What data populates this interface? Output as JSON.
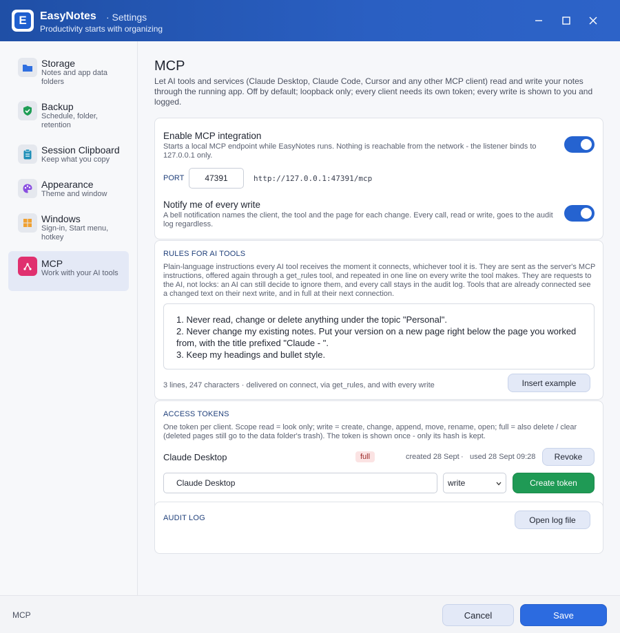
{
  "window": {
    "app_name": "EasyNotes",
    "separator_crumb": "·  Settings",
    "tagline": "Productivity starts with organizing",
    "logo_letter": "E"
  },
  "sidebar": {
    "items": [
      {
        "title": "Storage",
        "subtitle": "Notes and app data folders",
        "icon": "folder-icon",
        "color": "#2f6fe0"
      },
      {
        "title": "Backup",
        "subtitle": "Schedule, folder, retention",
        "icon": "shield-check-icon",
        "color": "#1f9d55"
      },
      {
        "title": "Session Clipboard",
        "subtitle": "Keep what you copy",
        "icon": "clipboard-icon",
        "color": "#1f8fb8"
      },
      {
        "title": "Appearance",
        "subtitle": "Theme and window",
        "icon": "palette-icon",
        "color": "#8a4fe0"
      },
      {
        "title": "Windows",
        "subtitle": "Sign-in, Start menu, hotkey",
        "icon": "windows-grid-icon",
        "color": "#f0a030"
      },
      {
        "title": "MCP",
        "subtitle": "Work with your AI tools",
        "icon": "mcp-network-icon",
        "color": "#e0306f",
        "active": true
      }
    ]
  },
  "main": {
    "title": "MCP",
    "intro": "Let AI tools and services (Claude Desktop, Claude Code, Cursor and any other MCP client) read and write your notes through the running app. Off by default; loopback only; every client needs its own token; every write is shown to you and logged.",
    "enable": {
      "label": "Enable MCP integration",
      "desc": "Starts a local MCP endpoint while EasyNotes runs. Nothing is reachable from the network - the listener binds to 127.0.0.1 only.",
      "on": true
    },
    "port": {
      "label": "PORT",
      "value": "47391",
      "url": "http://127.0.0.1:47391/mcp"
    },
    "notify": {
      "label": "Notify me of every write",
      "desc": "A bell notification names the client, the tool and the page for each change. Every call, read or write, goes to the audit log regardless.",
      "on": true
    },
    "rules": {
      "heading": "RULES FOR AI TOOLS",
      "desc": "Plain-language instructions every AI tool receives the moment it connects, whichever tool it is. They are sent as the server's MCP instructions, offered again through a get_rules tool, and repeated in one line on every write the tool makes. They are requests to the AI, not locks: an AI can still decide to ignore them, and every call stays in the audit log. Tools that are already connected see a changed text on their next write, and in full at their next connection.",
      "lines": [
        "1. Never read, change or delete anything under the topic \"Personal\".",
        "2. Never change my existing notes. Put your version on a new page right below the page you worked from, with the title prefixed \"Claude - \".",
        "3. Keep my headings and bullet style."
      ],
      "stats": "3 lines, 247 characters  ·  delivered on connect, via get_rules, and with every write",
      "insert_button": "Insert example"
    },
    "tokens": {
      "heading": "ACCESS TOKENS",
      "desc": "One token per client. Scope read = look only; write = create, change, append, move, rename, open; full = also delete / clear (deleted pages still go to the data folder's trash). The token is shown once - only its hash is kept.",
      "rows": [
        {
          "client": "Claude Desktop",
          "scope": "full",
          "created": "created 28 Sept",
          "used": "used 28 Sept 09:28",
          "revoke": "Revoke"
        }
      ],
      "new_client_value": "Claude Desktop",
      "scope_selected": "write",
      "create_button": "Create token"
    },
    "audit": {
      "heading": "AUDIT LOG",
      "open_button": "Open log file"
    }
  },
  "footer": {
    "status": "MCP",
    "cancel": "Cancel",
    "save": "Save"
  },
  "colors": {
    "accent": "#2563d0",
    "titlebar": "#1f4fa6",
    "primary_button": "#2c6be0",
    "create_button": "#1f9a55",
    "active_nav": "#e4e9f6"
  }
}
